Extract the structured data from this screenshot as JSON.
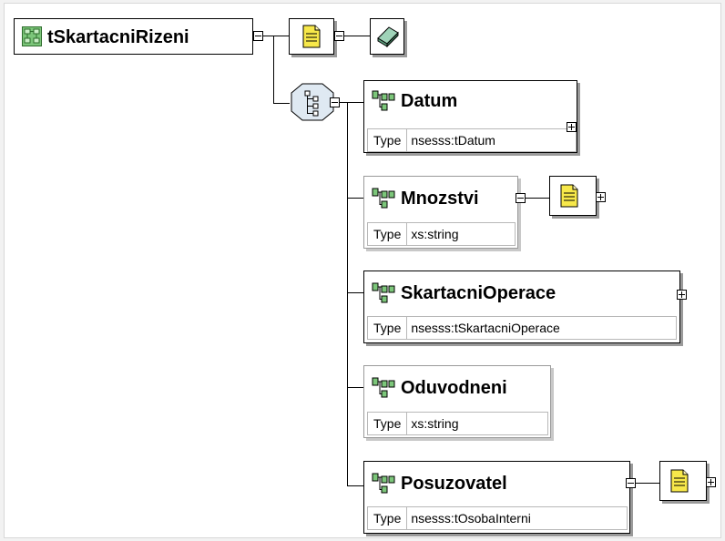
{
  "diagram": {
    "root": {
      "name": "tSkartacniRizeni",
      "icon": "complex-type-icon"
    },
    "annotation_icon": "documentation-icon",
    "appinfo_icon": "appinfo-book-icon",
    "compositor_icon": "sequence-compositor-icon",
    "element_icon": "element-icon",
    "type_label": "Type",
    "children": [
      {
        "name": "Datum",
        "type": "nsesss:tDatum",
        "optional": false,
        "expandable": true,
        "has_annotation": false
      },
      {
        "name": "Mnozstvi",
        "type": "xs:string",
        "optional": true,
        "expandable": false,
        "has_annotation": true
      },
      {
        "name": "SkartacniOperace",
        "type": "nsesss:tSkartacniOperace",
        "optional": false,
        "expandable": true,
        "has_annotation": false
      },
      {
        "name": "Oduvodneni",
        "type": "xs:string",
        "optional": true,
        "expandable": false,
        "has_annotation": false
      },
      {
        "name": "Posuzovatel",
        "type": "nsesss:tOsobaInterni",
        "optional": false,
        "expandable": true,
        "has_annotation": true
      }
    ]
  }
}
